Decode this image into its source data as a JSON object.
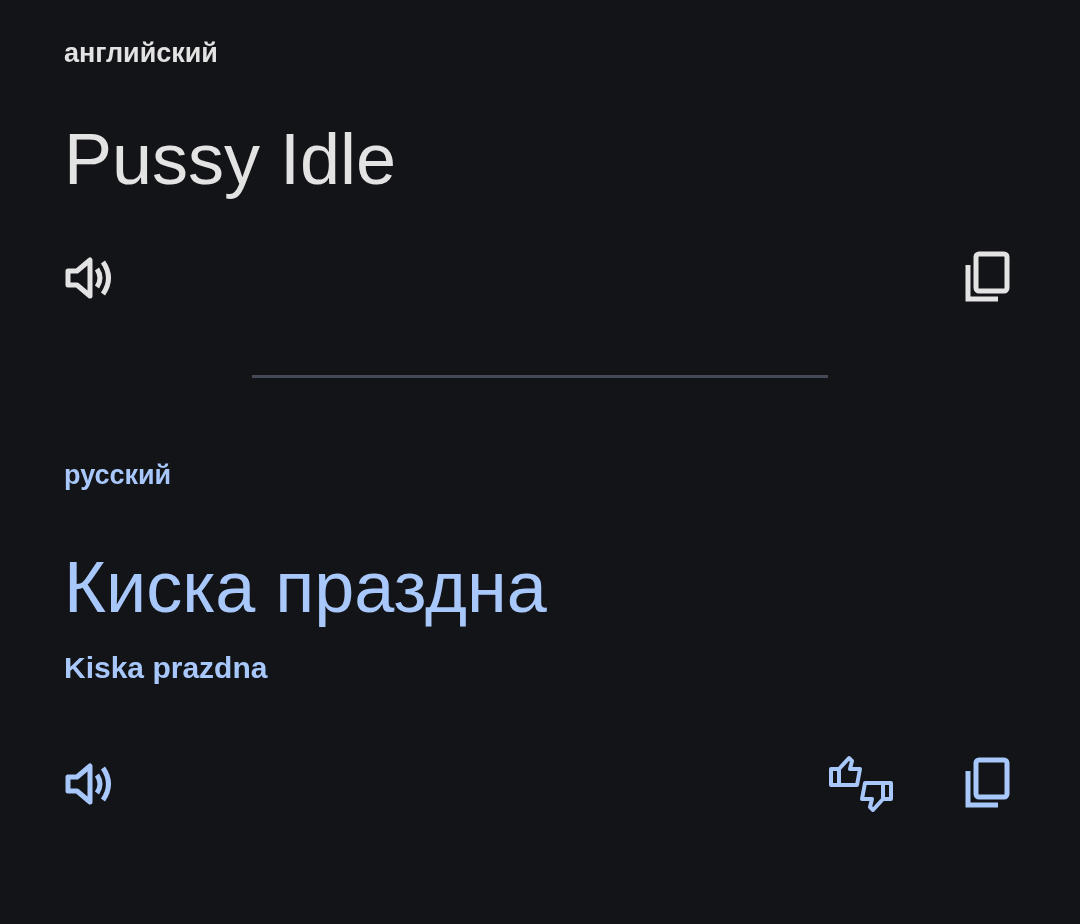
{
  "source": {
    "language": "английский",
    "text": "Pussy Idle"
  },
  "target": {
    "language": "русский",
    "text": "Киска праздна",
    "transliteration": "Kiska prazdna"
  }
}
